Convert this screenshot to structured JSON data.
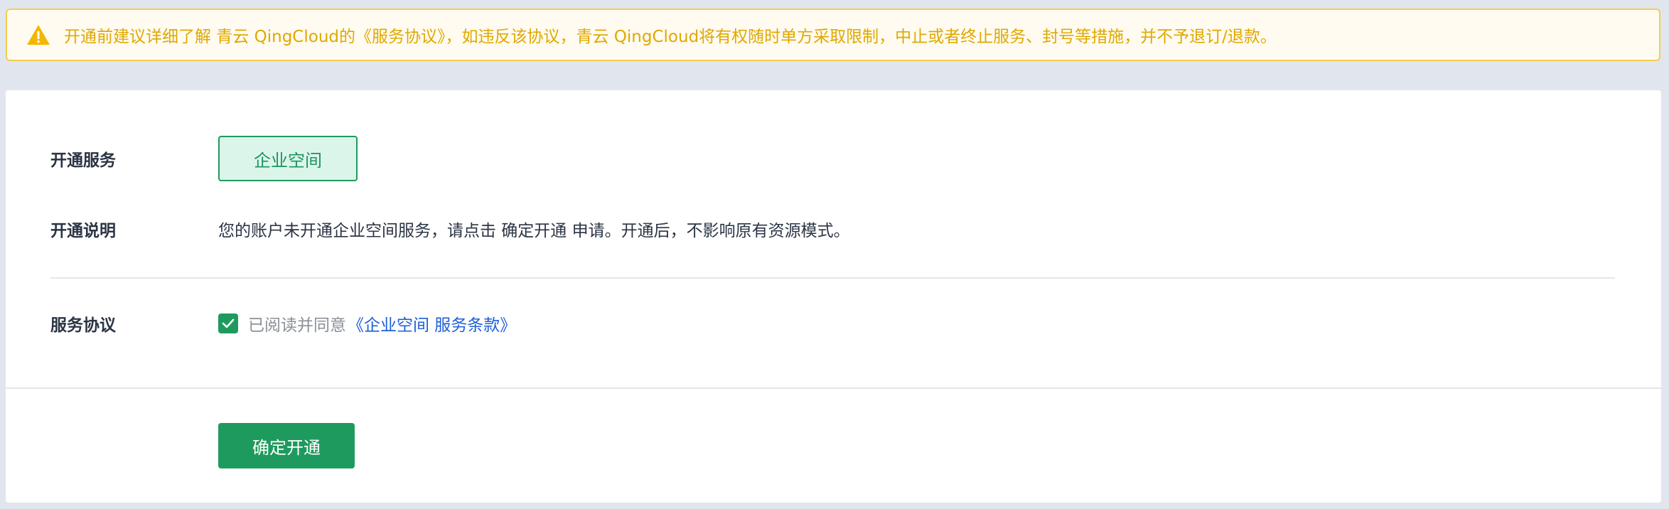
{
  "warning": {
    "icon": "warning-icon",
    "text": "开通前建议详细了解 青云 QingCloud的《服务协议》，如违反该协议，青云 QingCloud将有权随时单方采取限制，中止或者终止服务、封号等措施，并不予退订/退款。",
    "color": "#e0a800"
  },
  "form": {
    "service": {
      "label": "开通服务",
      "option": "企业空间"
    },
    "description": {
      "label": "开通说明",
      "text": "您的账户未开通企业空间服务，请点击 确定开通 申请。开通后，不影响原有资源模式。"
    },
    "agreement": {
      "label": "服务协议",
      "checked": true,
      "text": "已阅读并同意",
      "link": "《企业空间 服务条款》"
    },
    "confirm_button": "确定开通"
  },
  "colors": {
    "accent": "#1f9a5e",
    "link": "#1e5fd6",
    "warning_border": "#f5cd4f"
  }
}
